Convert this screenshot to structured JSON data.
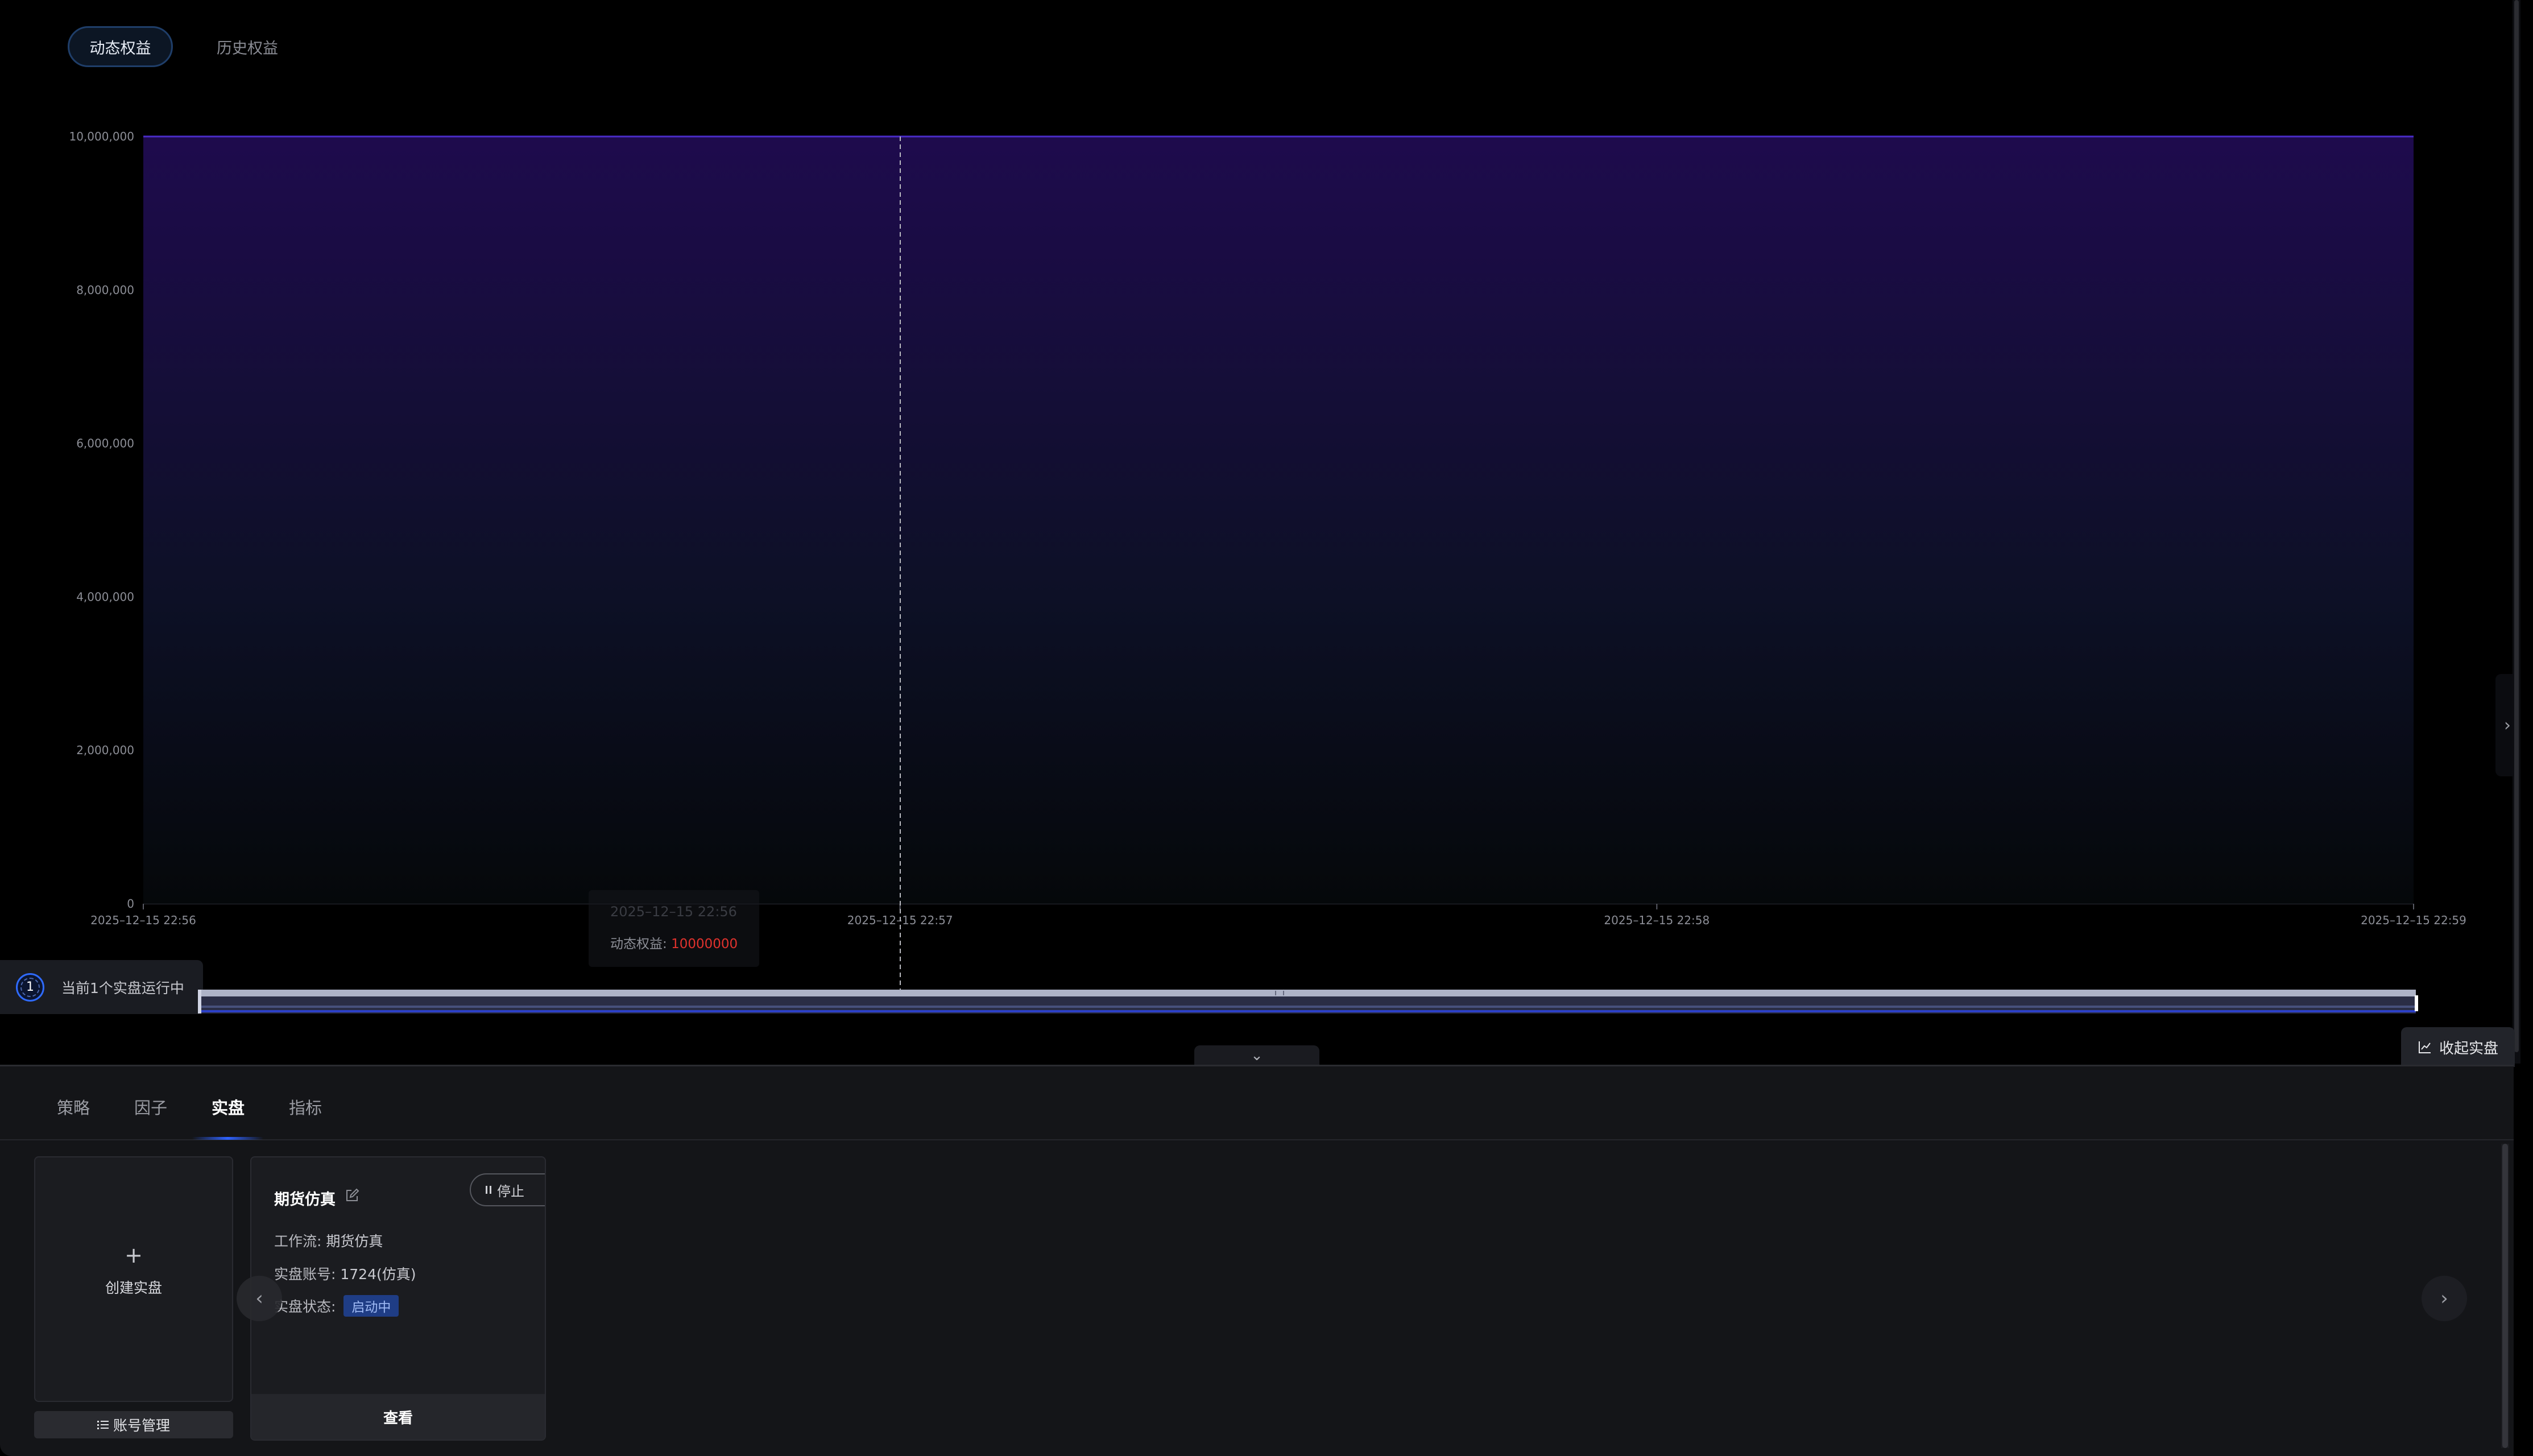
{
  "top_tabs": {
    "dynamic": "动态权益",
    "history": "历史权益"
  },
  "chart_data": {
    "type": "area",
    "x": [
      "2025-12-15 22:56",
      "2025-12-15 22:57",
      "2025-12-15 22:58",
      "2025-12-15 22:59"
    ],
    "series": [
      {
        "name": "动态权益",
        "values": [
          10000000,
          10000000,
          10000000,
          10000000
        ]
      }
    ],
    "y_ticks": [
      "0",
      "2,000,000",
      "4,000,000",
      "6,000,000",
      "8,000,000",
      "10,000,000"
    ],
    "x_ticks": [
      "2025–12–15 22:56",
      "2025–12–15 22:57",
      "2025–12–15 22:58",
      "2025–12–15 22:59"
    ],
    "ylim": [
      0,
      10000000
    ],
    "grid": true,
    "colors": {
      "line": "#4a2cc8",
      "fill_top": "#1e0b4d",
      "fill_bottom": "#05080a"
    }
  },
  "tooltip": {
    "date": "2025–12–15 22:56",
    "label": "动态权益: ",
    "value": "10000000"
  },
  "running_status": {
    "count": "1",
    "text": "当前1个实盘运行中"
  },
  "collapse_live": "收起实盘",
  "panel": {
    "tabs": [
      "策略",
      "因子",
      "实盘",
      "指标"
    ],
    "active_tab": "实盘",
    "create_label": "创建实盘",
    "account_mgmt": "账号管理",
    "card": {
      "title": "期货仿真",
      "stop": "停止",
      "workflow_label": "工作流: ",
      "workflow_value": "期货仿真",
      "account_label": "实盘账号: ",
      "account_value": "1724(仿真)",
      "status_label": "实盘状态: ",
      "status_value": "启动中",
      "view": "查看"
    }
  },
  "icons": {
    "plus": "+",
    "chevron_down": "⌄",
    "chevron_left": "‹",
    "chevron_right": "›"
  }
}
